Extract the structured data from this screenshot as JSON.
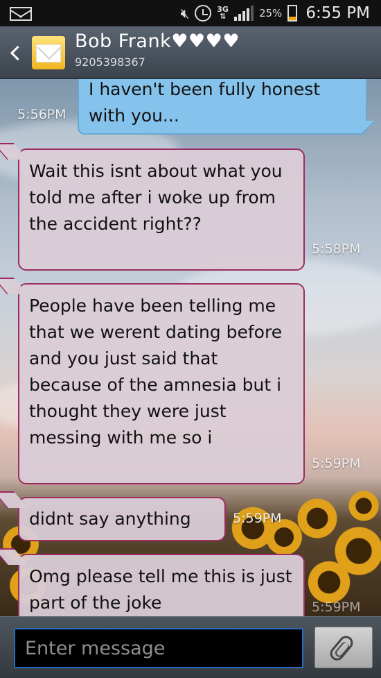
{
  "status_bar": {
    "battery_percent": "25%",
    "network_type": "3G",
    "time": "6:55 PM",
    "icons": [
      "mail-icon",
      "mute-icon",
      "alarm-icon",
      "3g-icon",
      "signal-icon",
      "battery-icon"
    ]
  },
  "header": {
    "contact_name": "Bob Frank♥♥♥♥",
    "contact_number": "9205398367",
    "back_icon": "chevron-left-icon",
    "avatar_icon": "envelope-icon"
  },
  "messages": [
    {
      "direction": "outgoing",
      "text": "I haven't been fully honest with you...",
      "time": "5:56PM"
    },
    {
      "direction": "incoming",
      "text": "Wait this isnt about what you told me after i woke up from the accident right??",
      "time": "5:58PM"
    },
    {
      "direction": "incoming",
      "text": "People have been telling me that we werent dating before and you just said that because of the amnesia but i thought they were just messing with me so i",
      "time": "5:59PM"
    },
    {
      "direction": "incoming",
      "text": "didnt say anything",
      "time": "5:59PM"
    },
    {
      "direction": "incoming",
      "text": "Omg please tell me this is just part of the joke",
      "time": "5:59PM"
    }
  ],
  "input": {
    "placeholder": "Enter message",
    "attach_icon": "paperclip-icon"
  },
  "colors": {
    "outgoing_bubble": "#86c3ec",
    "incoming_bubble": "#dacdd6",
    "incoming_border": "#9b2d63",
    "input_border": "#2a6bbf"
  }
}
